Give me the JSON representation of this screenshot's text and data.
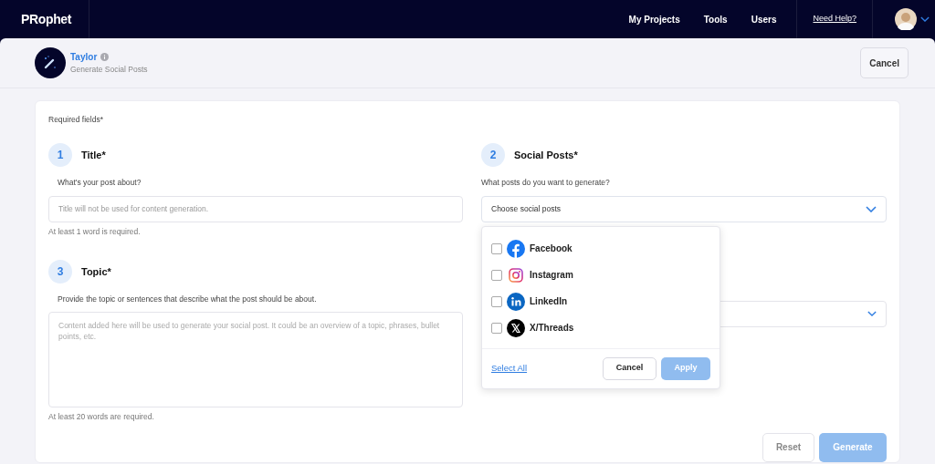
{
  "nav": {
    "logo": "PRophet",
    "links": [
      "My Projects",
      "Tools",
      "Users"
    ],
    "help": "Need Help?"
  },
  "header": {
    "name": "Taylor",
    "subtitle": "Generate Social Posts",
    "cancel": "Cancel"
  },
  "form": {
    "required_note": "Required fields*",
    "title_step": {
      "number": "1",
      "label": "Title*",
      "question": "What's your post about?",
      "placeholder": "Title will not be used for content generation.",
      "helper": "At least 1 word is required."
    },
    "topic_step": {
      "number": "3",
      "label": "Topic*",
      "question": "Provide the topic or sentences that describe what the post should be about.",
      "placeholder": "Content added here will be used to generate your social post. It could be an overview of a topic, phrases, bullet points, etc.",
      "helper": "At least 20 words are required."
    },
    "social_step": {
      "number": "2",
      "label": "Social Posts*",
      "question": "What posts do you want to generate?",
      "select_value": "Choose social posts",
      "expanded": true
    },
    "buttons": {
      "reset": "Reset",
      "generate": "Generate"
    }
  },
  "dropdown": {
    "options": [
      {
        "kind": "facebook",
        "label": "Facebook",
        "checked": false
      },
      {
        "kind": "instagram",
        "label": "Instagram",
        "checked": false
      },
      {
        "kind": "linkedin",
        "label": "LinkedIn",
        "checked": false
      },
      {
        "kind": "x",
        "label": "X/Threads",
        "checked": false
      }
    ],
    "select_all": "Select All",
    "cancel": "Cancel",
    "apply": "Apply"
  }
}
